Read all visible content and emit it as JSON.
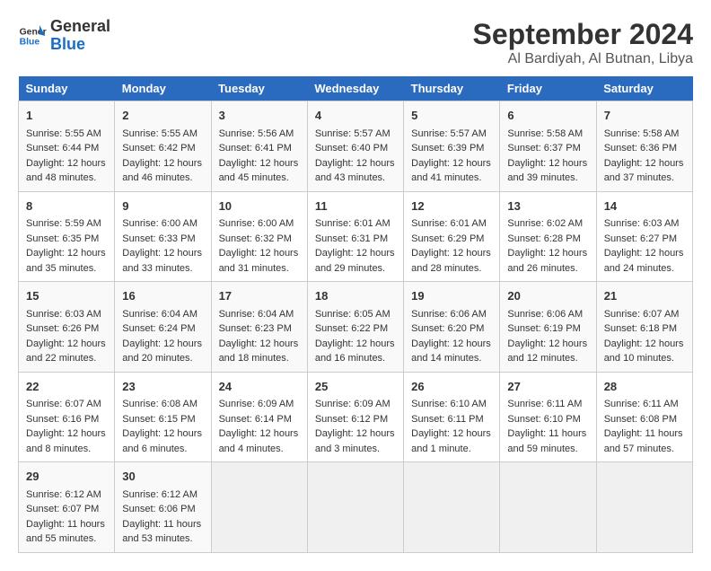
{
  "logo": {
    "line1": "General",
    "line2": "Blue"
  },
  "title": "September 2024",
  "location": "Al Bardiyah, Al Butnan, Libya",
  "days_of_week": [
    "Sunday",
    "Monday",
    "Tuesday",
    "Wednesday",
    "Thursday",
    "Friday",
    "Saturday"
  ],
  "weeks": [
    [
      {
        "day": "1",
        "sunrise": "5:55 AM",
        "sunset": "6:44 PM",
        "daylight": "Daylight: 12 hours and 48 minutes."
      },
      {
        "day": "2",
        "sunrise": "5:55 AM",
        "sunset": "6:42 PM",
        "daylight": "Daylight: 12 hours and 46 minutes."
      },
      {
        "day": "3",
        "sunrise": "5:56 AM",
        "sunset": "6:41 PM",
        "daylight": "Daylight: 12 hours and 45 minutes."
      },
      {
        "day": "4",
        "sunrise": "5:57 AM",
        "sunset": "6:40 PM",
        "daylight": "Daylight: 12 hours and 43 minutes."
      },
      {
        "day": "5",
        "sunrise": "5:57 AM",
        "sunset": "6:39 PM",
        "daylight": "Daylight: 12 hours and 41 minutes."
      },
      {
        "day": "6",
        "sunrise": "5:58 AM",
        "sunset": "6:37 PM",
        "daylight": "Daylight: 12 hours and 39 minutes."
      },
      {
        "day": "7",
        "sunrise": "5:58 AM",
        "sunset": "6:36 PM",
        "daylight": "Daylight: 12 hours and 37 minutes."
      }
    ],
    [
      {
        "day": "8",
        "sunrise": "5:59 AM",
        "sunset": "6:35 PM",
        "daylight": "Daylight: 12 hours and 35 minutes."
      },
      {
        "day": "9",
        "sunrise": "6:00 AM",
        "sunset": "6:33 PM",
        "daylight": "Daylight: 12 hours and 33 minutes."
      },
      {
        "day": "10",
        "sunrise": "6:00 AM",
        "sunset": "6:32 PM",
        "daylight": "Daylight: 12 hours and 31 minutes."
      },
      {
        "day": "11",
        "sunrise": "6:01 AM",
        "sunset": "6:31 PM",
        "daylight": "Daylight: 12 hours and 29 minutes."
      },
      {
        "day": "12",
        "sunrise": "6:01 AM",
        "sunset": "6:29 PM",
        "daylight": "Daylight: 12 hours and 28 minutes."
      },
      {
        "day": "13",
        "sunrise": "6:02 AM",
        "sunset": "6:28 PM",
        "daylight": "Daylight: 12 hours and 26 minutes."
      },
      {
        "day": "14",
        "sunrise": "6:03 AM",
        "sunset": "6:27 PM",
        "daylight": "Daylight: 12 hours and 24 minutes."
      }
    ],
    [
      {
        "day": "15",
        "sunrise": "6:03 AM",
        "sunset": "6:26 PM",
        "daylight": "Daylight: 12 hours and 22 minutes."
      },
      {
        "day": "16",
        "sunrise": "6:04 AM",
        "sunset": "6:24 PM",
        "daylight": "Daylight: 12 hours and 20 minutes."
      },
      {
        "day": "17",
        "sunrise": "6:04 AM",
        "sunset": "6:23 PM",
        "daylight": "Daylight: 12 hours and 18 minutes."
      },
      {
        "day": "18",
        "sunrise": "6:05 AM",
        "sunset": "6:22 PM",
        "daylight": "Daylight: 12 hours and 16 minutes."
      },
      {
        "day": "19",
        "sunrise": "6:06 AM",
        "sunset": "6:20 PM",
        "daylight": "Daylight: 12 hours and 14 minutes."
      },
      {
        "day": "20",
        "sunrise": "6:06 AM",
        "sunset": "6:19 PM",
        "daylight": "Daylight: 12 hours and 12 minutes."
      },
      {
        "day": "21",
        "sunrise": "6:07 AM",
        "sunset": "6:18 PM",
        "daylight": "Daylight: 12 hours and 10 minutes."
      }
    ],
    [
      {
        "day": "22",
        "sunrise": "6:07 AM",
        "sunset": "6:16 PM",
        "daylight": "Daylight: 12 hours and 8 minutes."
      },
      {
        "day": "23",
        "sunrise": "6:08 AM",
        "sunset": "6:15 PM",
        "daylight": "Daylight: 12 hours and 6 minutes."
      },
      {
        "day": "24",
        "sunrise": "6:09 AM",
        "sunset": "6:14 PM",
        "daylight": "Daylight: 12 hours and 4 minutes."
      },
      {
        "day": "25",
        "sunrise": "6:09 AM",
        "sunset": "6:12 PM",
        "daylight": "Daylight: 12 hours and 3 minutes."
      },
      {
        "day": "26",
        "sunrise": "6:10 AM",
        "sunset": "6:11 PM",
        "daylight": "Daylight: 12 hours and 1 minute."
      },
      {
        "day": "27",
        "sunrise": "6:11 AM",
        "sunset": "6:10 PM",
        "daylight": "Daylight: 11 hours and 59 minutes."
      },
      {
        "day": "28",
        "sunrise": "6:11 AM",
        "sunset": "6:08 PM",
        "daylight": "Daylight: 11 hours and 57 minutes."
      }
    ],
    [
      {
        "day": "29",
        "sunrise": "6:12 AM",
        "sunset": "6:07 PM",
        "daylight": "Daylight: 11 hours and 55 minutes."
      },
      {
        "day": "30",
        "sunrise": "6:12 AM",
        "sunset": "6:06 PM",
        "daylight": "Daylight: 11 hours and 53 minutes."
      },
      null,
      null,
      null,
      null,
      null
    ]
  ]
}
